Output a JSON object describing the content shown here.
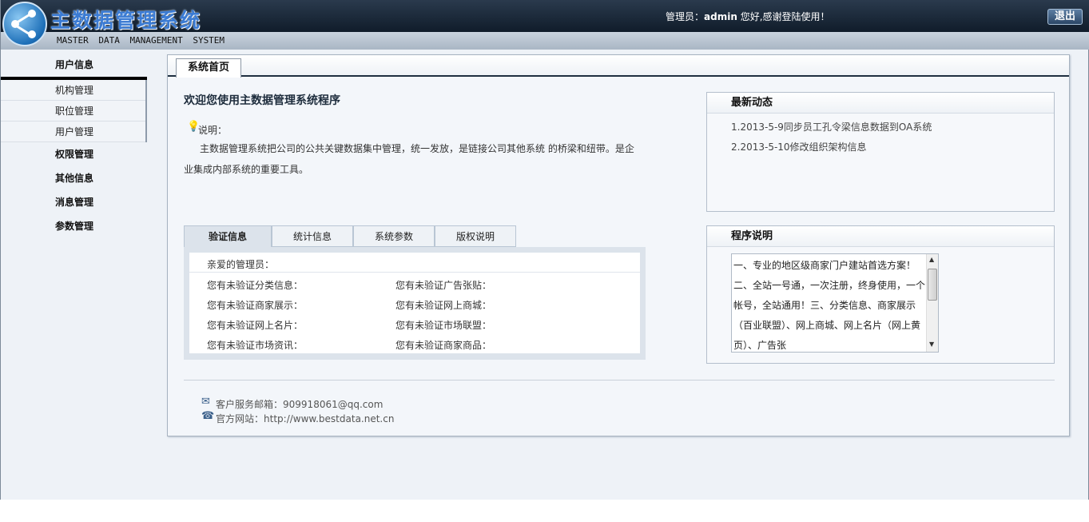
{
  "header": {
    "title": "主数据管理系统",
    "subtitle": "MASTER DATA MANAGEMENT SYSTEM",
    "greeting_prefix": "管理员：",
    "user": "admin",
    "greeting_suffix": " 您好,感谢登陆使用！",
    "logout_label": "退出"
  },
  "sidebar": {
    "head": "用户信息",
    "sub_items": [
      "机构管理",
      "职位管理",
      "用户管理"
    ],
    "groups": [
      "权限管理",
      "其他信息",
      "消息管理",
      "参数管理"
    ]
  },
  "main": {
    "tab_label": "系统首页",
    "welcome": "欢迎您使用主数据管理系统程序",
    "desc_label": "说明：",
    "desc_text": "主数据管理系统把公司的公共关键数据集中管理，统一发放，是链接公司其他系统 的桥梁和纽带。是企业集成内部系统的重要工具。",
    "tabs": [
      "验证信息",
      "统计信息",
      "系统参数",
      "版权说明"
    ],
    "tab_greet": "亲爱的管理员：",
    "verify_left": [
      "您有未验证分类信息：",
      "您有未验证商家展示：",
      "您有未验证网上名片：",
      "您有未验证市场资讯："
    ],
    "verify_right": [
      "您有未验证广告张贴：",
      "您有未验证网上商城：",
      "您有未验证市场联盟：",
      "您有未验证商家商品："
    ]
  },
  "news": {
    "title": "最新动态",
    "items": [
      "1.2013-5-9同步员工孔令梁信息数据到OA系统",
      "2.2013-5-10修改组织架构信息"
    ]
  },
  "program": {
    "title": "程序说明",
    "text": "一、专业的地区级商家门户建站首选方案！二、全站一号通，一次注册，终身使用，一个帐号，全站通用！三、分类信息、商家展示（百业联盟）、网上商城、网上名片（网上黄页）、广告张"
  },
  "footer": {
    "email_label": "客户服务邮箱：",
    "email": "909918061@qq.com",
    "site_label": "官方网站：",
    "site": "http://www.bestdata.net.cn"
  },
  "icons": [
    "logo-icon",
    "bulb-icon",
    "mail-icon",
    "phone-icon",
    "scroll-up-icon",
    "scroll-down-icon"
  ]
}
